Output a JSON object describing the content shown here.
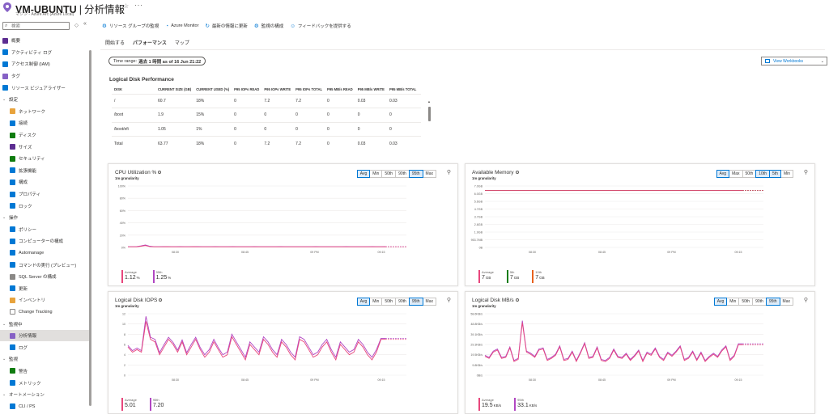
{
  "header": {
    "title": "VM-UBUNTU",
    "separator": "|",
    "page": "分析情報",
    "subtitle": "マシン - Azure Arc (Azure Local)",
    "star": "☆",
    "more": "···"
  },
  "sidebar": {
    "search_placeholder": "検索",
    "items": [
      {
        "label": "概要",
        "kind": "top",
        "color": "#5c2d91"
      },
      {
        "label": "アクティビティ ログ",
        "kind": "top",
        "color": "#0078d4"
      },
      {
        "label": "アクセス制御 (IAM)",
        "kind": "top",
        "color": "#0078d4"
      },
      {
        "label": "タグ",
        "kind": "top",
        "color": "#8661c5"
      },
      {
        "label": "リソース ビジュアライザー",
        "kind": "top",
        "color": "#0078d4"
      },
      {
        "label": "設定",
        "kind": "group"
      },
      {
        "label": "ネットワーク",
        "kind": "child",
        "color": "#e8a33c"
      },
      {
        "label": "接続",
        "kind": "child",
        "color": "#0078d4"
      },
      {
        "label": "ディスク",
        "kind": "child",
        "color": "#107c10"
      },
      {
        "label": "サイズ",
        "kind": "child",
        "color": "#5c2d91"
      },
      {
        "label": "セキュリティ",
        "kind": "child",
        "color": "#107c10"
      },
      {
        "label": "拡張機能",
        "kind": "child",
        "color": "#0078d4"
      },
      {
        "label": "構成",
        "kind": "child",
        "color": "#0078d4"
      },
      {
        "label": "プロパティ",
        "kind": "child",
        "color": "#0078d4"
      },
      {
        "label": "ロック",
        "kind": "child",
        "color": "#0078d4"
      },
      {
        "label": "操作",
        "kind": "group"
      },
      {
        "label": "ポリシー",
        "kind": "child",
        "color": "#0078d4"
      },
      {
        "label": "コンピューターの構成",
        "kind": "child",
        "color": "#0078d4"
      },
      {
        "label": "Automanage",
        "kind": "child",
        "color": "#0078d4"
      },
      {
        "label": "コマンドの実行 (プレビュー)",
        "kind": "child",
        "color": "#0078d4"
      },
      {
        "label": "SQL Server の構成",
        "kind": "child",
        "color": "#8a8886"
      },
      {
        "label": "更新",
        "kind": "child",
        "color": "#0078d4"
      },
      {
        "label": "インベントリ",
        "kind": "child",
        "color": "#e8a33c"
      },
      {
        "label": "Change Tracking",
        "kind": "child",
        "color": "#ffffff"
      },
      {
        "label": "監視中",
        "kind": "group"
      },
      {
        "label": "分析情報",
        "kind": "child",
        "color": "#8661c5",
        "active": true
      },
      {
        "label": "ログ",
        "kind": "child",
        "color": "#0078d4"
      },
      {
        "label": "監視",
        "kind": "group"
      },
      {
        "label": "警告",
        "kind": "child",
        "color": "#107c10"
      },
      {
        "label": "メトリック",
        "kind": "child",
        "color": "#0078d4"
      },
      {
        "label": "オートメーション",
        "kind": "group"
      },
      {
        "label": "CLI / PS",
        "kind": "child",
        "color": "#0078d4"
      }
    ]
  },
  "commands": [
    {
      "label": "リソース グループの監視",
      "icon": "monitor-icon",
      "glyph": "⚙"
    },
    {
      "label": "Azure Monitor",
      "icon": "azure-monitor-icon",
      "glyph": "◔"
    },
    {
      "label": "最新の情報に更新",
      "icon": "refresh-icon",
      "glyph": "↻"
    },
    {
      "label": "監視の構成",
      "icon": "gear-icon",
      "glyph": "⚙"
    },
    {
      "label": "フィードバックを提供する",
      "icon": "smiley-icon",
      "glyph": "☺"
    }
  ],
  "tabs": [
    {
      "label": "開始する",
      "active": false
    },
    {
      "label": "パフォーマンス",
      "active": true
    },
    {
      "label": "マップ",
      "active": false
    }
  ],
  "time_range": {
    "label": "Time range:",
    "value": "過去 1 時間 as of 16 Jun 21:22"
  },
  "workbooks_label": "View Workbooks",
  "disk": {
    "title": "Logical Disk Performance",
    "columns": [
      "DISK",
      "CURRENT SIZE (GB)",
      "CURRENT USED (%)",
      "P95 IOPs READ",
      "P95 IOPs WRITE",
      "P95 IOPs TOTAL",
      "P95 MB/s READ",
      "P95 MB/s WRITE",
      "P95 MB/s TOTAL"
    ],
    "rows": [
      [
        "/",
        "60.7",
        "18%",
        "0",
        "7.2",
        "7.2",
        "0",
        "0.03",
        "0.03"
      ],
      [
        "/boot",
        "1.9",
        "15%",
        "0",
        "0",
        "0",
        "0",
        "0",
        "0"
      ],
      [
        "/boot/efi",
        "1.05",
        "1%",
        "0",
        "0",
        "0",
        "0",
        "0",
        "0"
      ],
      [
        "Total",
        "63.77",
        "18%",
        "0",
        "7.2",
        "7.2",
        "0",
        "0.03",
        "0.03"
      ]
    ]
  },
  "chart_data": [
    {
      "type": "line",
      "title": "CPU Utilization %",
      "granularity": "1m granularity",
      "buttons": [
        "Avg",
        "Min",
        "50th",
        "90th",
        "95th",
        "Max"
      ],
      "active_buttons": [
        "Avg",
        "95th"
      ],
      "y_ticks": [
        "100%",
        "80%",
        "60%",
        "40%",
        "20%",
        "0%"
      ],
      "ylim": [
        0,
        100
      ],
      "x_ticks": [
        "08:30",
        "08:45",
        "09 PM",
        "09:15"
      ],
      "series": [
        {
          "name": "Average",
          "value": "1.12",
          "unit": "%",
          "color": "#e8467c",
          "values": [
            1.0,
            1.0,
            1.0,
            2.0,
            3.0,
            1.5,
            1.0,
            1.0,
            1.1,
            1.2,
            1.0,
            1.0,
            1.1,
            1.0,
            1.0,
            1.2,
            1.1,
            1.0,
            1.0,
            1.0,
            1.1,
            1.0,
            1.0,
            1.0,
            1.1,
            1.0,
            1.0,
            1.0,
            1.0,
            1.1,
            1.0,
            1.0,
            1.0,
            1.0,
            1.0,
            1.1,
            1.0,
            1.0,
            1.0,
            1.0,
            1.0,
            1.0,
            1.0,
            1.1,
            1.0,
            1.0,
            1.0,
            1.0,
            1.0,
            1.0,
            1.1,
            1.0,
            1.0,
            1.0,
            1.0,
            1.0,
            1.1,
            1.0,
            1.0,
            1.1
          ]
        },
        {
          "name": "95th",
          "value": "1.25",
          "unit": "%",
          "color": "#b146c2",
          "values": [
            1.2,
            1.2,
            1.3,
            2.5,
            4.0,
            2.0,
            1.2,
            1.2,
            1.3,
            1.3,
            1.2,
            1.2,
            1.3,
            1.2,
            1.2,
            1.3,
            1.3,
            1.2,
            1.2,
            1.2,
            1.3,
            1.2,
            1.2,
            1.2,
            1.3,
            1.2,
            1.2,
            1.2,
            1.2,
            1.3,
            1.2,
            1.2,
            1.2,
            1.2,
            1.2,
            1.3,
            1.2,
            1.2,
            1.2,
            1.2,
            1.2,
            1.2,
            1.2,
            1.3,
            1.2,
            1.2,
            1.2,
            1.2,
            1.2,
            1.2,
            1.3,
            1.2,
            1.2,
            1.2,
            1.2,
            1.2,
            1.3,
            1.2,
            1.2,
            1.25
          ]
        }
      ]
    },
    {
      "type": "line",
      "title": "Available Memory",
      "granularity": "1m granularity",
      "buttons": [
        "Avg",
        "Max",
        "50th",
        "10th",
        "5th",
        "Min"
      ],
      "active_buttons": [
        "Avg",
        "10th",
        "5th"
      ],
      "y_ticks": [
        "7.0GB",
        "6.0GB",
        "5.6GB",
        "4.7GB",
        "3.7GB",
        "2.8GB",
        "1.9GB",
        "953.7MB",
        "0B"
      ],
      "ylim": [
        0,
        7.5
      ],
      "x_ticks": [
        "08:30",
        "08:45",
        "09 PM",
        "09:15"
      ],
      "series": [
        {
          "name": "Average",
          "value": "7",
          "unit": "GB",
          "color": "#e8467c",
          "values": [
            6.95,
            6.95,
            6.95,
            6.95,
            6.95,
            6.95,
            6.95,
            6.95,
            6.95,
            6.95
          ]
        },
        {
          "name": "5th",
          "value": "7",
          "unit": "GB",
          "color": "#107c10",
          "values": [
            6.95,
            6.95,
            6.95,
            6.95,
            6.95,
            6.95,
            6.95,
            6.95,
            6.95,
            6.95
          ]
        },
        {
          "name": "10th",
          "value": "7",
          "unit": "GB",
          "color": "#e8601c",
          "values": [
            6.95,
            6.95,
            6.95,
            6.95,
            6.95,
            6.95,
            6.95,
            6.95,
            6.95,
            6.95
          ]
        }
      ]
    },
    {
      "type": "line",
      "title": "Logical Disk IOPS",
      "granularity": "1m granularity",
      "buttons": [
        "Avg",
        "Min",
        "50th",
        "90th",
        "95th",
        "Max"
      ],
      "active_buttons": [
        "Avg",
        "95th"
      ],
      "y_ticks": [
        "12",
        "10",
        "8",
        "6",
        "4",
        "2",
        "0"
      ],
      "ylim": [
        0,
        12
      ],
      "x_ticks": [
        "08:30",
        "08:45",
        "09 PM",
        "09:15"
      ],
      "series": [
        {
          "name": "Average",
          "value": "5.01",
          "unit": "",
          "color": "#e8467c",
          "values": [
            5.5,
            4.5,
            5.0,
            4.5,
            10.5,
            7.0,
            6.5,
            4.0,
            5.5,
            7.0,
            6.0,
            4.5,
            6.5,
            4.0,
            5.5,
            7.0,
            5.0,
            3.5,
            4.5,
            6.5,
            5.0,
            3.5,
            4.0,
            7.5,
            6.0,
            4.5,
            3.0,
            6.0,
            5.0,
            4.0,
            7.0,
            6.0,
            4.5,
            3.5,
            6.5,
            5.5,
            4.0,
            3.0,
            7.0,
            6.5,
            5.0,
            3.5,
            4.0,
            5.5,
            6.5,
            4.5,
            3.0,
            6.0,
            5.0,
            4.0,
            4.5,
            6.5,
            5.5,
            4.0,
            3.0,
            4.5,
            7.0,
            7.0
          ]
        },
        {
          "name": "95th",
          "value": "7.20",
          "unit": "",
          "color": "#b146c2",
          "values": [
            5.8,
            4.8,
            5.3,
            4.8,
            11.5,
            7.4,
            7.0,
            4.4,
            6.0,
            7.4,
            6.4,
            4.9,
            6.9,
            4.4,
            6.0,
            7.4,
            5.4,
            4.0,
            5.0,
            7.0,
            5.4,
            4.0,
            4.5,
            8.0,
            6.5,
            5.0,
            3.5,
            6.5,
            5.5,
            4.5,
            7.5,
            6.5,
            5.0,
            4.0,
            7.0,
            6.0,
            4.5,
            3.5,
            7.5,
            7.0,
            5.5,
            4.0,
            4.5,
            6.0,
            7.0,
            5.0,
            3.5,
            6.5,
            5.5,
            4.5,
            5.0,
            7.0,
            6.0,
            4.5,
            3.5,
            5.0,
            7.2,
            7.2
          ]
        }
      ]
    },
    {
      "type": "line",
      "title": "Logical Disk MB/s",
      "granularity": "1m granularity",
      "buttons": [
        "Avg",
        "Min",
        "50th",
        "90th",
        "95th",
        "Max"
      ],
      "active_buttons": [
        "Avg",
        "95th"
      ],
      "y_ticks": [
        "58.6KB/s",
        "48.8KB/s",
        "39.1KB/s",
        "29.3KB/s",
        "19.5KB/s",
        "9.8KB/s",
        "0B/s"
      ],
      "ylim": [
        0,
        58.6
      ],
      "x_ticks": [
        "08:30",
        "08:45",
        "09 PM",
        "09:15"
      ],
      "series": [
        {
          "name": "Average",
          "value": "19.5",
          "unit": "KB/s",
          "color": "#e8467c",
          "values": [
            18,
            16,
            22,
            24,
            16,
            17,
            26,
            13,
            15,
            50,
            22,
            20,
            17,
            24,
            25,
            14,
            16,
            19,
            27,
            14,
            15,
            22,
            13,
            21,
            30,
            16,
            17,
            26,
            14,
            13,
            16,
            24,
            17,
            16,
            20,
            14,
            18,
            23,
            13,
            21,
            19,
            25,
            17,
            14,
            21,
            18,
            22,
            27,
            14,
            16,
            22,
            14,
            21,
            13,
            17,
            20,
            17,
            23,
            27,
            14,
            18,
            29,
            29
          ]
        },
        {
          "name": "95th",
          "value": "33.1",
          "unit": "KB/s",
          "color": "#b146c2",
          "values": [
            19,
            17,
            23,
            25,
            17,
            18,
            27,
            14,
            16,
            52,
            23,
            21,
            18,
            25,
            26,
            15,
            17,
            20,
            28,
            15,
            16,
            23,
            14,
            22,
            31,
            17,
            18,
            27,
            15,
            14,
            17,
            25,
            18,
            17,
            21,
            15,
            19,
            24,
            14,
            22,
            20,
            26,
            18,
            15,
            22,
            19,
            23,
            28,
            15,
            17,
            23,
            15,
            22,
            14,
            18,
            21,
            18,
            24,
            28,
            15,
            19,
            30,
            30
          ]
        }
      ]
    }
  ]
}
